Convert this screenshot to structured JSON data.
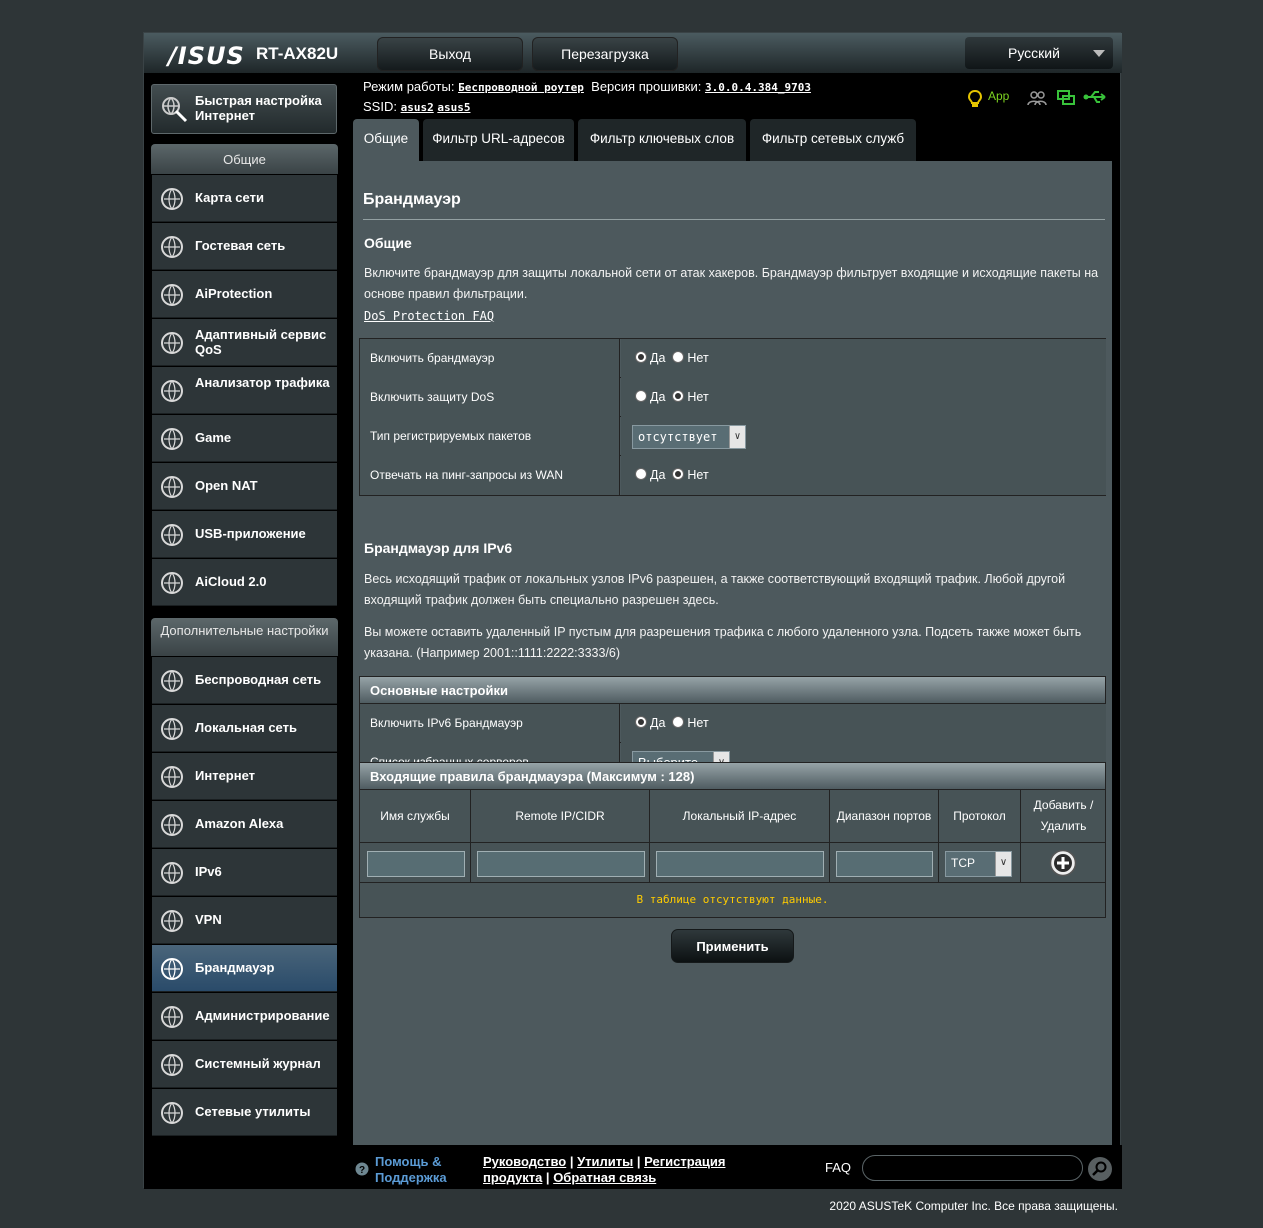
{
  "header": {
    "logo": "/ISUS",
    "model": "RT-AX82U",
    "logout_label": "Выход",
    "reboot_label": "Перезагрузка",
    "language": "Русский"
  },
  "info": {
    "mode_label": "Режим работы:",
    "mode_value": "Беспроводной роутер",
    "fw_label": "Версия прошивки:",
    "fw_value": "3.0.0.4.384_9703",
    "ssid_label": "SSID:",
    "ssid1": "asus2",
    "ssid2": "asus5",
    "app_label": "App"
  },
  "sidebar": {
    "quick_setup": "Быстрая настройка Интернет",
    "general_header": "Общие",
    "general_items": [
      {
        "label": "Карта сети",
        "icon": "network-map-icon"
      },
      {
        "label": "Гостевая сеть",
        "icon": "guest-network-icon"
      },
      {
        "label": "AiProtection",
        "icon": "aiprotection-icon"
      },
      {
        "label": "Адаптивный сервис QoS",
        "icon": "qos-icon"
      },
      {
        "label": "Анализатор трафика",
        "icon": "traffic-analyzer-icon"
      },
      {
        "label": "Game",
        "icon": "game-icon"
      },
      {
        "label": "Open NAT",
        "icon": "open-nat-icon"
      },
      {
        "label": "USB-приложение",
        "icon": "usb-app-icon"
      },
      {
        "label": "AiCloud 2.0",
        "icon": "aicloud-icon"
      }
    ],
    "advanced_header": "Дополнительные настройки",
    "advanced_items": [
      {
        "label": "Беспроводная сеть",
        "icon": "wireless-icon"
      },
      {
        "label": "Локальная сеть",
        "icon": "lan-icon"
      },
      {
        "label": "Интернет",
        "icon": "wan-icon"
      },
      {
        "label": "Amazon Alexa",
        "icon": "alexa-icon"
      },
      {
        "label": "IPv6",
        "icon": "ipv6-icon"
      },
      {
        "label": "VPN",
        "icon": "vpn-icon"
      },
      {
        "label": "Брандмауэр",
        "icon": "firewall-icon"
      },
      {
        "label": "Администрирование",
        "icon": "admin-icon"
      },
      {
        "label": "Системный журнал",
        "icon": "syslog-icon"
      },
      {
        "label": "Сетевые утилиты",
        "icon": "network-tools-icon"
      }
    ]
  },
  "tabs": [
    "Общие",
    "Фильтр URL-адресов",
    "Фильтр ключевых слов",
    "Фильтр сетевых служб"
  ],
  "main": {
    "title": "Брандмауэр",
    "general_title": "Общие",
    "general_text": "Включите брандмауэр для защиты локальной сети от атак хакеров. Брандмауэр фильтрует входящие и исходящие пакеты на основе правил фильтрации.",
    "dos_link": "DoS Protection FAQ",
    "yes": "Да",
    "no": "Нет",
    "settings": [
      {
        "label": "Включить брандмауэр",
        "type": "radio",
        "value": "yes"
      },
      {
        "label": "Включить защиту DoS",
        "type": "radio",
        "value": "no"
      },
      {
        "label": "Тип регистрируемых пакетов",
        "type": "select",
        "value": "отсутствует"
      },
      {
        "label": "Отвечать на пинг-запросы из WAN",
        "type": "radio",
        "value": "no"
      }
    ],
    "ipv6_title": "Брандмауэр для IPv6",
    "ipv6_text1": "Весь исходящий трафик от локальных узлов IPv6 разрешен, а также соответствующий входящий трафик. Любой другой входящий трафик должен быть специально разрешен здесь.",
    "ipv6_text2": "Вы можете оставить удаленный IP пустым для разрешения трафика с любого удаленного узла. Подсеть также может быть указана. (Например 2001::1111:2222:3333/6)",
    "basic_header": "Основные настройки",
    "ipv6_enable_label": "Включить IPv6 Брандмауэр",
    "ipv6_enable_value": "yes",
    "fav_servers_label": "Список избранных серверов",
    "fav_servers_value": "Выберите",
    "rules_header": "Входящие правила брандмауэра (Максимум : 128)",
    "rules_columns": [
      "Имя службы",
      "Remote IP/CIDR",
      "Локальный IP-адрес",
      "Диапазон портов",
      "Протокол",
      "Добавить / Удалить"
    ],
    "protocol_value": "TCP",
    "empty_text": "В таблице отсутствуют данные.",
    "apply_label": "Применить"
  },
  "footer": {
    "help1": "Помощь &",
    "help2": "Поддержка",
    "manual": "Руководство",
    "utilities": "Утилиты",
    "registration": "Регистрация",
    "product": "продукта",
    "feedback": "Обратная связь",
    "faq": "FAQ",
    "copyright": "2020 ASUSTeK Computer Inc. Все права защищены."
  }
}
